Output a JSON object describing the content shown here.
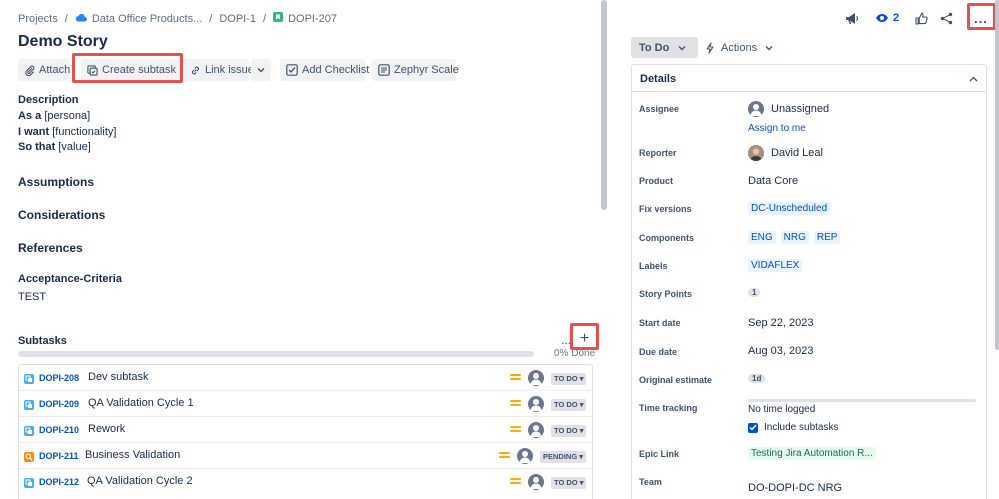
{
  "breadcrumbs": {
    "projects": "Projects",
    "project": "Data Office Products...",
    "parent": "DOPI-1",
    "issue": "DOPI-207"
  },
  "issue": {
    "title": "Demo Story"
  },
  "toolbar": {
    "attach": "Attach",
    "create_subtask": "Create subtask",
    "link_issue": "Link issue",
    "add_checklist": "Add Checklist",
    "zephyr": "Zephyr Scale"
  },
  "description": {
    "heading": "Description",
    "lines": [
      {
        "bold": "As a",
        "text": "[persona]"
      },
      {
        "bold": "I want",
        "text": "[functionality]"
      },
      {
        "bold": "So that",
        "text": "[value]"
      }
    ]
  },
  "sections": {
    "assumptions": "Assumptions",
    "considerations": "Considerations",
    "references": "References",
    "acceptance_heading": "Acceptance-Criteria",
    "acceptance_value": "TEST"
  },
  "subtasks": {
    "heading": "Subtasks",
    "more": "...",
    "add": "+",
    "progress_label": "0% Done",
    "progress_fraction": 0,
    "items": [
      {
        "key": "DOPI-208",
        "summary": "Dev subtask",
        "status": "TO DO",
        "type": "subtask"
      },
      {
        "key": "DOPI-209",
        "summary": "QA Validation Cycle 1",
        "status": "TO DO",
        "type": "subtask"
      },
      {
        "key": "DOPI-210",
        "summary": "Rework",
        "status": "TO DO",
        "type": "subtask"
      },
      {
        "key": "DOPI-211",
        "summary": "Business Validation",
        "status": "PENDING",
        "type": "business"
      },
      {
        "key": "DOPI-212",
        "summary": "QA Validation Cycle 2",
        "status": "TO DO",
        "type": "subtask"
      }
    ]
  },
  "header_actions": {
    "watchers": "2",
    "more": "..."
  },
  "status": {
    "label": "To Do",
    "actions": "Actions"
  },
  "details": {
    "heading": "Details",
    "assignee_label": "Assignee",
    "assignee_value": "Unassigned",
    "assign_to_me": "Assign to me",
    "reporter_label": "Reporter",
    "reporter_value": "David Leal",
    "product_label": "Product",
    "product_value": "Data Core",
    "fix_versions_label": "Fix versions",
    "fix_versions_value": "DC-Unscheduled",
    "components_label": "Components",
    "components": [
      "ENG",
      "NRG",
      "REP"
    ],
    "labels_label": "Labels",
    "labels_value": "VIDAFLEX",
    "story_points_label": "Story Points",
    "story_points_value": "1",
    "start_date_label": "Start date",
    "start_date_value": "Sep 22, 2023",
    "due_date_label": "Due date",
    "due_date_value": "Aug 03, 2023",
    "original_estimate_label": "Original estimate",
    "original_estimate_value": "1d",
    "time_tracking_label": "Time tracking",
    "time_tracking_value": "No time logged",
    "include_subtasks": "Include subtasks",
    "epic_link_label": "Epic Link",
    "epic_link_value": "Testing Jira Automation R...",
    "team_label": "Team",
    "team_value": "DO-DOPI-DC NRG"
  },
  "colors": {
    "highlight": "#e5514e",
    "link": "#0052cc",
    "text": "#172b4d",
    "subtle": "#42526e",
    "priority": "#ffab00",
    "lozenge_bg": "#dfe1e6",
    "epic_bg": "#e3fcef"
  }
}
